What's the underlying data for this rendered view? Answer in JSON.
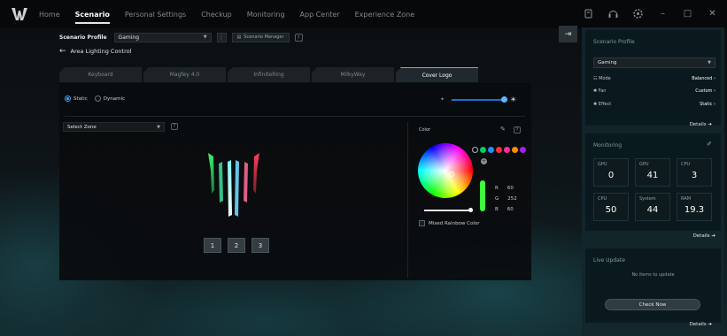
{
  "nav": {
    "items": [
      "Home",
      "Scenario",
      "Personal Settings",
      "Checkup",
      "Monitoring",
      "App Center",
      "Experience Zone"
    ],
    "active": "Scenario"
  },
  "window": {
    "minimize": "–",
    "maximize": "□",
    "close": "✕"
  },
  "profile": {
    "label": "Scenario Profile",
    "selected": "Gaming",
    "manager_label": "Scenario Manager"
  },
  "breadcrumb": {
    "title": "Area Lighting Control"
  },
  "tabs": [
    "Keyboard",
    "Magfey 4.0",
    "InfiniteRing",
    "MilkyWay",
    "Cover Logo"
  ],
  "active_tab": "Cover Logo",
  "lighting": {
    "static_label": "Static",
    "dynamic_label": "Dynamic",
    "mode": "Static",
    "brightness": 1.0,
    "zone_placeholder": "Select Zone",
    "zones": [
      "1",
      "2",
      "3"
    ]
  },
  "color": {
    "label": "Color",
    "swatches": [
      "#00d060",
      "#1e90ff",
      "#ff3030",
      "#ff2fa0",
      "#ff8c00",
      "#a020f0"
    ],
    "r_label": "R",
    "g_label": "G",
    "b_label": "B",
    "r": "60",
    "g": "252",
    "b": "60",
    "mixed_label": "Mixed Rainbow Color"
  },
  "sidebar": {
    "scenario_profile": {
      "title": "Scenario Profile",
      "selected": "Gaming",
      "rows": [
        {
          "label": "Mode",
          "value": "Balanced",
          "icon": "mode-icon"
        },
        {
          "label": "Fan",
          "value": "Custom",
          "icon": "fan-icon"
        },
        {
          "label": "Effect",
          "value": "Static",
          "icon": "effect-icon"
        }
      ],
      "details": "Details"
    },
    "monitoring": {
      "title": "Monitoring",
      "tiles": [
        {
          "label": "GPU",
          "value": "0"
        },
        {
          "label": "GPU",
          "value": "41"
        },
        {
          "label": "CPU",
          "value": "3"
        },
        {
          "label": "CPU",
          "value": "50"
        },
        {
          "label": "System",
          "value": "44"
        },
        {
          "label": "RAM",
          "value": "19.3"
        }
      ],
      "details": "Details"
    },
    "live_update": {
      "title": "Live Update",
      "empty": "No items to update",
      "button": "Check Now",
      "details": "Details"
    }
  }
}
